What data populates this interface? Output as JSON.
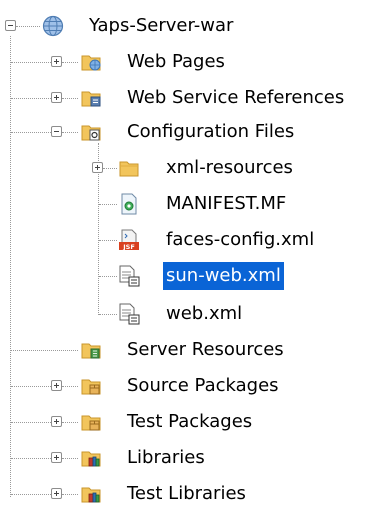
{
  "tree": {
    "root": {
      "label": "Yaps-Server-war",
      "icon": "globe-icon",
      "expanded": true
    },
    "items": [
      {
        "label": "Web Pages",
        "icon": "web-pages-folder-icon",
        "expanded": false
      },
      {
        "label": "Web Service References",
        "icon": "web-service-folder-icon",
        "expanded": false
      },
      {
        "label": "Configuration Files",
        "icon": "config-folder-icon",
        "expanded": true
      },
      {
        "label": "xml-resources",
        "icon": "folder-icon",
        "expanded": false
      },
      {
        "label": "MANIFEST.MF",
        "icon": "manifest-file-icon"
      },
      {
        "label": "faces-config.xml",
        "icon": "jsf-file-icon"
      },
      {
        "label": "sun-web.xml",
        "icon": "xml-descriptor-icon",
        "selected": true
      },
      {
        "label": "web.xml",
        "icon": "xml-descriptor-icon"
      },
      {
        "label": "Server Resources",
        "icon": "server-resources-icon"
      },
      {
        "label": "Source Packages",
        "icon": "packages-folder-icon",
        "expanded": false
      },
      {
        "label": "Test Packages",
        "icon": "packages-folder-icon",
        "expanded": false
      },
      {
        "label": "Libraries",
        "icon": "libraries-folder-icon",
        "expanded": false
      },
      {
        "label": "Test Libraries",
        "icon": "libraries-folder-icon",
        "expanded": false
      }
    ]
  },
  "colors": {
    "selection": "#0a64d6",
    "folder": "#f2c55c",
    "connector": "#9a9a9a"
  }
}
